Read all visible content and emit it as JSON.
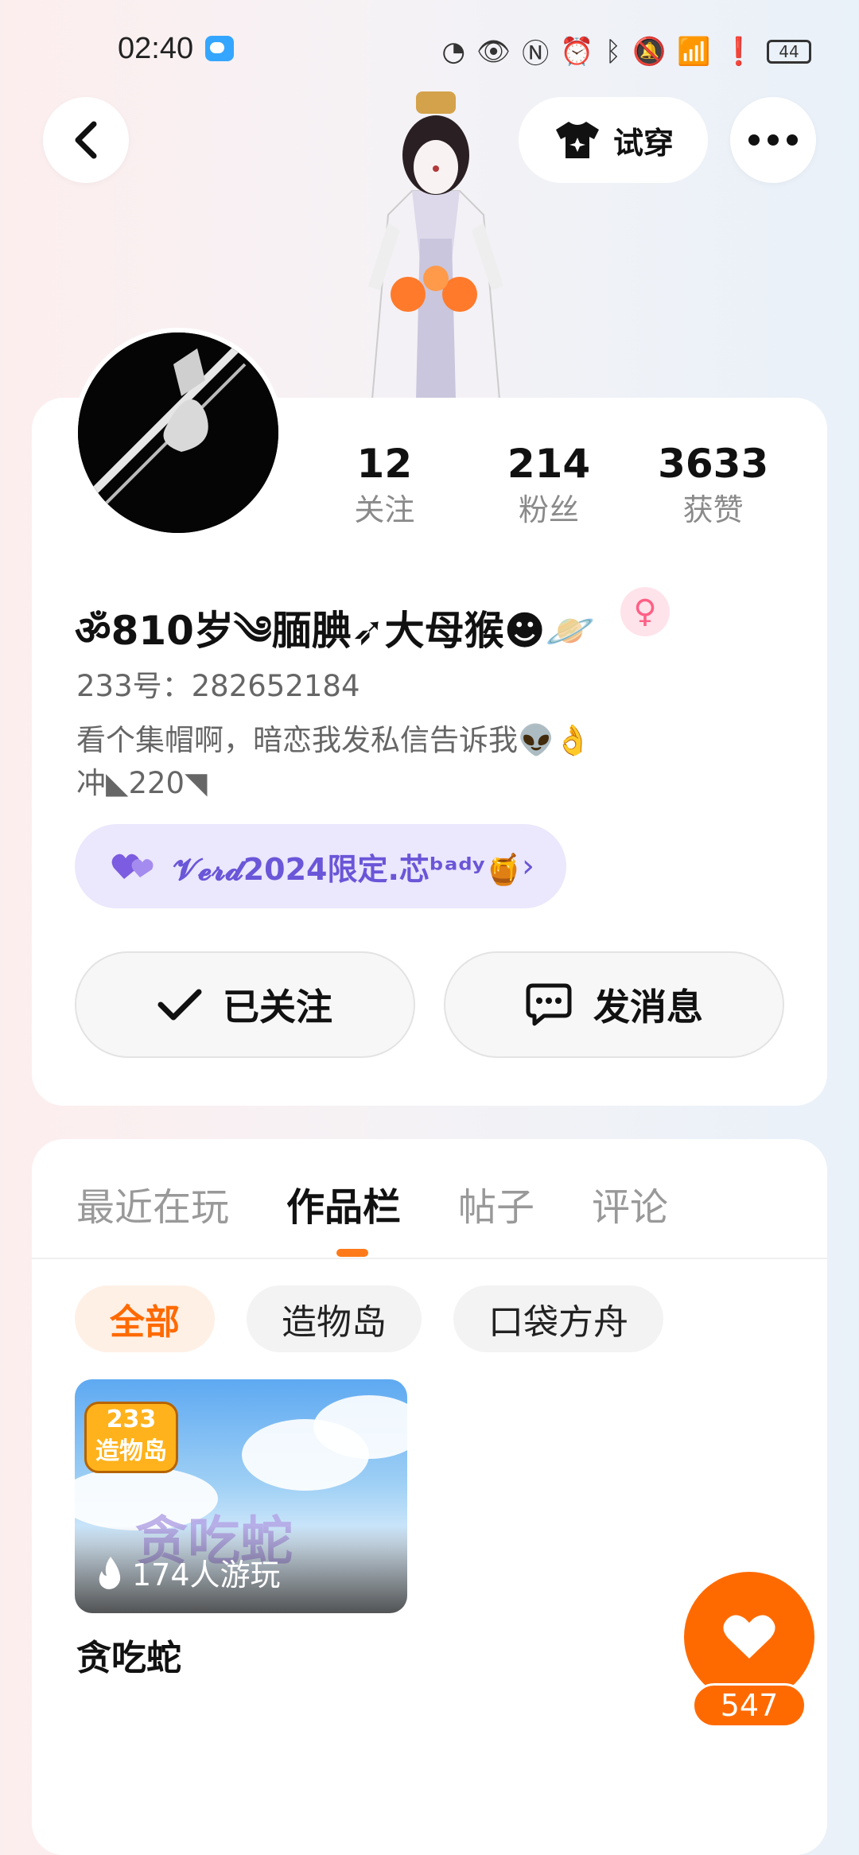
{
  "status_bar": {
    "time": "02:40",
    "icons": [
      "speed-icon",
      "eye-icon",
      "nfc-icon",
      "alarm-icon",
      "bluetooth-icon",
      "mute-icon",
      "wifi-icon",
      "alert-icon"
    ],
    "battery": "44"
  },
  "header": {
    "try_on_label": "试穿"
  },
  "profile": {
    "stats": [
      {
        "value": "12",
        "label": "关注"
      },
      {
        "value": "214",
        "label": "粉丝"
      },
      {
        "value": "3633",
        "label": "获赞"
      }
    ],
    "nickname": "ॐ810岁༄腼腆➶大母猴☻🪐",
    "gender_symbol": "♀",
    "uid": "233号：282652184",
    "bio_line1": "看个集帽啊，暗恋我发私信告诉我👽👌",
    "bio_line2": "冲◣220◥",
    "badge_text": "𝓥𝓮𝓻𝓭2024限定.芯ᵇᵃᵈʸ🍯",
    "followed_label": "已关注",
    "message_label": "发消息"
  },
  "works": {
    "tabs": [
      "最近在玩",
      "作品栏",
      "帖子",
      "评论"
    ],
    "active_tab": "作品栏",
    "filters": [
      "全部",
      "造物岛",
      "口袋方舟"
    ],
    "active_filter": "全部",
    "items": [
      {
        "title": "贪吃蛇",
        "players": "174人游玩",
        "logo_line1": "233",
        "logo_line2": "造物岛",
        "watermark": "贪吃蛇"
      }
    ]
  },
  "like": {
    "count": "547"
  },
  "colors": {
    "accent": "#ff6a00",
    "badge_purple": "#6a56d8",
    "female_pink": "#ff5f86"
  }
}
